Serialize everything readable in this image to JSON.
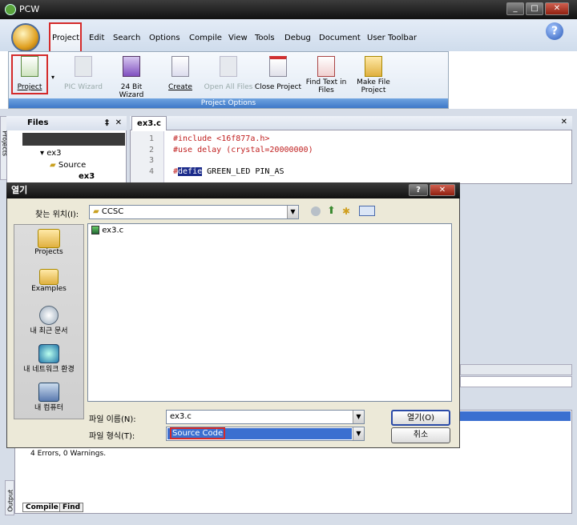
{
  "window": {
    "title": "PCW"
  },
  "menu": {
    "items": [
      "Project",
      "Edit",
      "Search",
      "Options",
      "Compile",
      "View",
      "Tools",
      "Debug",
      "Document",
      "User Toolbar"
    ]
  },
  "ribbon": {
    "group_label": "Project Options",
    "buttons": [
      {
        "label": "Project",
        "icon": "project-icon"
      },
      {
        "label": "PIC Wizard",
        "icon": "pic-wizard-icon",
        "disabled": true
      },
      {
        "label": "24 Bit Wizard",
        "icon": "wizard-24bit-icon"
      },
      {
        "label": "Create",
        "icon": "create-icon"
      },
      {
        "label": "Open All Files",
        "icon": "open-all-icon",
        "disabled": true
      },
      {
        "label": "Close Project",
        "icon": "close-project-icon"
      },
      {
        "label1": "Find Text in",
        "label2": "Files",
        "icon": "find-text-icon"
      },
      {
        "label1": "Make File",
        "label2": "Project",
        "icon": "make-file-icon"
      }
    ]
  },
  "files_pane": {
    "title": "Files",
    "vertical_tab": "Projects",
    "tree": [
      "ex3",
      "Source",
      "ex3"
    ]
  },
  "editor": {
    "tab": "ex3.c",
    "lines": [
      {
        "n": "1",
        "text": "#include <16f877a.h>"
      },
      {
        "n": "2",
        "text": "#use delay (crystal=20000000)"
      },
      {
        "n": "3",
        "text": ""
      },
      {
        "n": "4",
        "pre": "#",
        "sel": "defie",
        "text": " GREEN_LED PIN_AS"
      }
    ]
  },
  "dialog": {
    "title": "열기",
    "look_in_label": "찾는 위치(I):",
    "look_in_value": "CCSC",
    "places": [
      "Projects",
      "Examples",
      "내 최근 문서",
      "내 네트워크 환경",
      "내 컴퓨터"
    ],
    "files": [
      "ex3.c"
    ],
    "filename_label": "파일 이름(N):",
    "filename_value": "ex3.c",
    "filetype_label": "파일 형식(T):",
    "filetype_value": "Source Code",
    "open_button": "열기(O)",
    "cancel_button": "취소"
  },
  "output": {
    "message": "4 Errors,  0 Warnings.",
    "tabs": [
      "Compile",
      "Find"
    ],
    "vertical_tab": "Output"
  }
}
